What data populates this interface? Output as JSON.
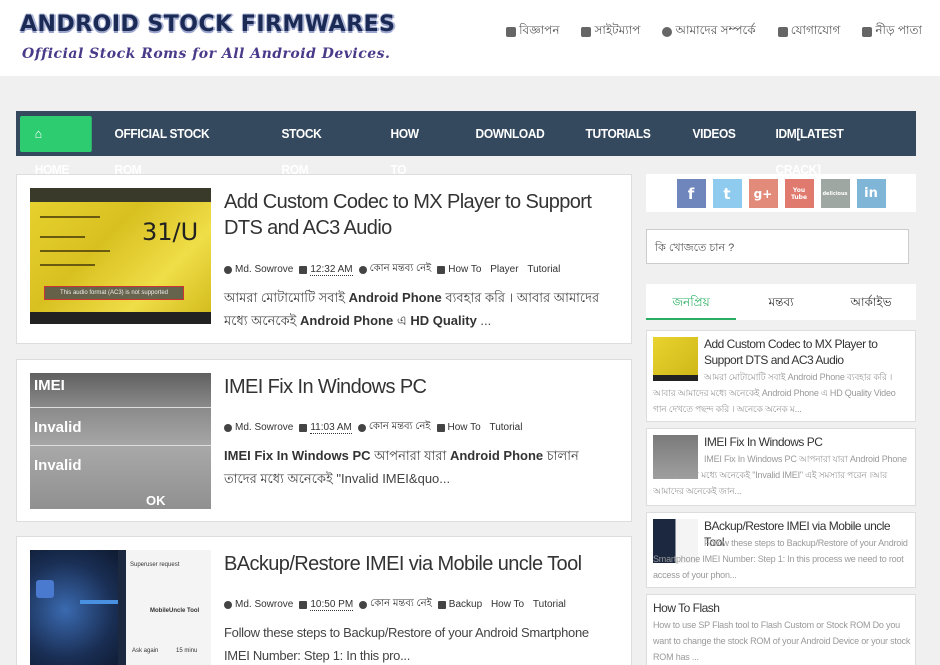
{
  "site": {
    "title": "ANDROID STOCK FIRMWARES",
    "tagline": "Official Stock Roms for All Android Devices."
  },
  "topnav": [
    {
      "icon": "bullhorn-icon",
      "label": "বিজ্ঞাপন"
    },
    {
      "icon": "sitemap-icon",
      "label": "সাইটম্যাপ"
    },
    {
      "icon": "user-icon",
      "label": "আমাদের সম্পর্কে"
    },
    {
      "icon": "envelope-icon",
      "label": "যোগাযোগ"
    },
    {
      "icon": "home-icon",
      "label": "নীড় পাতা"
    }
  ],
  "nav": {
    "home": "HOME",
    "items": [
      "OFFICIAL STOCK ROM",
      "STOCK ROM",
      "HOW TO",
      "DOWNLOAD",
      "TUTORIALS",
      "VIDEOS",
      "IDM[LATEST CRACK]"
    ]
  },
  "posts": [
    {
      "title": "Add Custom Codec to MX Player to Support DTS and AC3 Audio",
      "author": "Md. Sowrove",
      "time": "12:32 AM",
      "comments": "কোন মন্তব্য নেই",
      "tags": [
        "How To",
        "Player",
        "Tutorial"
      ],
      "excerpt_pre": "আমরা মোটামোটি সবাই ",
      "excerpt_b1": "Android Phone",
      "excerpt_mid": " ব্যবহার করি । আবার আমাদের মধ্যে অনেকেই ",
      "excerpt_b2": "Android Phone",
      "excerpt_mid2": " এ ",
      "excerpt_b3": "HD Quality",
      "excerpt_end": " ...",
      "thumb_caption": "This audio format (AC3) is not supported",
      "thumb_text": "31/U"
    },
    {
      "title": "IMEI Fix In Windows PC",
      "author": "Md. Sowrove",
      "time": "11:03 AM",
      "comments": "কোন মন্তব্য নেই",
      "tags": [
        "How To",
        "Tutorial"
      ],
      "excerpt_pre": " IMEI Fix In Windows PC",
      "excerpt_mid": " আপনারা যারা ",
      "excerpt_b1": "Android Phone",
      "excerpt_end": " চালান তাদের মধ্যে অনেকেই \"Invalid IMEI&quo...",
      "thumb_lines": [
        "IMEI",
        "Invalid",
        "Invalid",
        "OK"
      ]
    },
    {
      "title": "BAckup/Restore IMEI via Mobile uncle Tool",
      "author": "Md. Sowrove",
      "time": "10:50 PM",
      "comments": "কোন মন্তব্য নেই",
      "tags": [
        "Backup",
        "How To",
        "Tutorial"
      ],
      "excerpt": "Follow these steps to Backup/Restore of your Android Smartphone IMEI Number: Step 1: In this pro...",
      "thumb_lines": [
        "Superuser request",
        "MobileUncle Tool",
        "Ask again",
        "15 minu"
      ]
    }
  ],
  "sidebar": {
    "social": [
      "f",
      "t",
      "g+",
      "You Tube",
      "delicious",
      "in"
    ],
    "search_placeholder": "কি খোজতে চান ?",
    "tabs": [
      "জনপ্রিয়",
      "মন্তব্য",
      "আর্কাইভ"
    ],
    "popular": [
      {
        "title": "Add Custom Codec to MX Player to Support DTS and AC3 Audio",
        "excerpt": "আমরা মোটামোটি সবাই Android Phone ব্যবহার করি । আবার আমাদের মধ্যে অনেকেই Android Phone এ HD Quality Video গান দেখতে পছন্দ করি । অনেকে অনেক ম..."
      },
      {
        "title": "IMEI Fix In Windows PC",
        "excerpt": "IMEI Fix In Windows PC আপনারা যারা Android Phone চালান তাদের মধ্যে অনেকেই \"Invalid IMEI\" এই সমস্যার পরেন ।আর আমাদের অনেকেই জান..."
      },
      {
        "title": "BAckup/Restore IMEI via Mobile uncle Tool",
        "excerpt": "Follow these steps to Backup/Restore of your Android Smartphone IMEI Number: Step 1: In this process we need to root access of your phon..."
      },
      {
        "title": "How To Flash",
        "excerpt": "How to use SP Flash tool to Flash Custom or Stock ROM Do you want to change the stock ROM of your Android Device or your stock ROM has ..."
      }
    ]
  },
  "colors": {
    "navbar": "#34495e",
    "home_active": "#2ecc71",
    "tab_active": "#27ae60"
  }
}
